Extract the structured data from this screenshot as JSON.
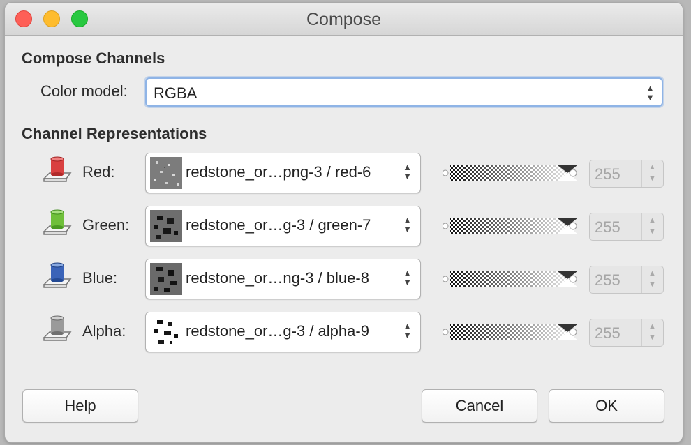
{
  "window": {
    "title": "Compose"
  },
  "compose_channels": {
    "heading": "Compose Channels",
    "color_model_label": "Color model:",
    "color_model_value": "RGBA"
  },
  "channel_representations": {
    "heading": "Channel Representations",
    "channels": [
      {
        "label": "Red:",
        "layer": "redstone_or…png-3 / red-6",
        "value": "255",
        "color": "#d94040"
      },
      {
        "label": "Green:",
        "layer": "redstone_or…g-3 / green-7",
        "value": "255",
        "color": "#6fbf3a"
      },
      {
        "label": "Blue:",
        "layer": "redstone_or…ng-3 / blue-8",
        "value": "255",
        "color": "#3a63b8"
      },
      {
        "label": "Alpha:",
        "layer": "redstone_or…g-3 / alpha-9",
        "value": "255",
        "color": "#9a9a9a"
      }
    ]
  },
  "buttons": {
    "help": "Help",
    "cancel": "Cancel",
    "ok": "OK"
  },
  "icons": {
    "spin_up": "▲",
    "spin_down": "▼"
  }
}
